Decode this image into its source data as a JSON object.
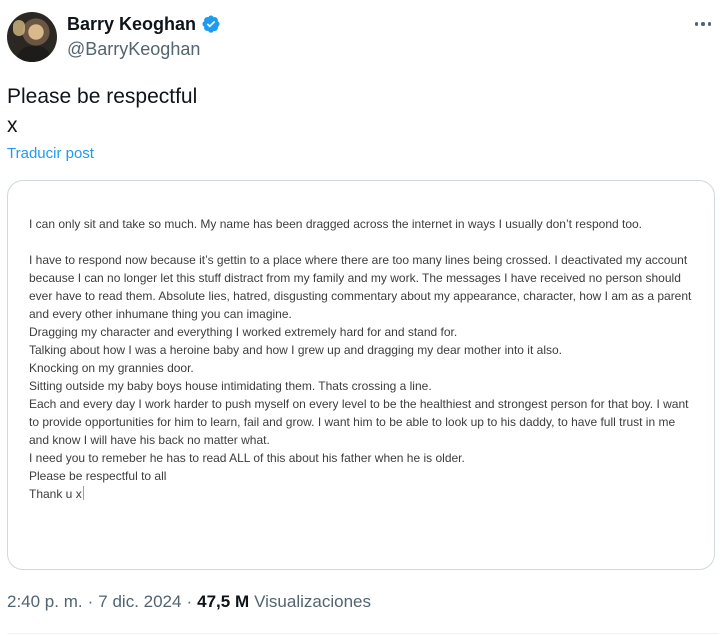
{
  "author": {
    "display_name": "Barry Keoghan",
    "handle": "@BarryKeoghan",
    "verified": true,
    "avatar_icon": "profile-photo"
  },
  "menu": {
    "icon": "more-options-icon"
  },
  "tweet": {
    "text_line1": "Please be respectful",
    "text_line2": "x",
    "translate_label": "Traducir post"
  },
  "note_image": {
    "lines": [
      "I can only sit and take so much. My name has been dragged across the internet in ways I usually don’t respond too.",
      "",
      "I have to respond now because it’s gettin to a place where there are too many lines being crossed. I deactivated my account",
      "because I can no longer let this stuff distract from my family and my work. The messages I have received no person should",
      "ever have to read them. Absolute lies, hatred, disgusting commentary about my appearance, character, how I am as a parent",
      "and every other inhumane thing you can imagine.",
      "Dragging my character and everything I worked extremely hard for and stand for.",
      "Talking about how I was a heroine baby and how I grew up and dragging my dear mother into it also.",
      "Knocking on my grannies door.",
      "Sitting outside my baby boys house intimidating them. Thats crossing a line.",
      "Each and every day I work harder to push myself on every level to be the healthiest and strongest person for that boy. I want",
      "to provide opportunities for him to learn, fail and grow. I want him to be able to look up to his daddy, to have full trust in me",
      "and know I will have his back no matter what.",
      "I need you to remeber he has to read ALL of this about his father when he is older.",
      "Please be respectful to all",
      "Thank u x"
    ]
  },
  "meta": {
    "time": "2:40 p. m.",
    "separator": "·",
    "date": "7 dic. 2024",
    "views_count": "47,5 M",
    "views_label": "Visualizaciones"
  },
  "colors": {
    "accent": "#1d9bf0",
    "text_primary": "#0f1419",
    "text_secondary": "#536471",
    "border": "#cfd9de"
  }
}
